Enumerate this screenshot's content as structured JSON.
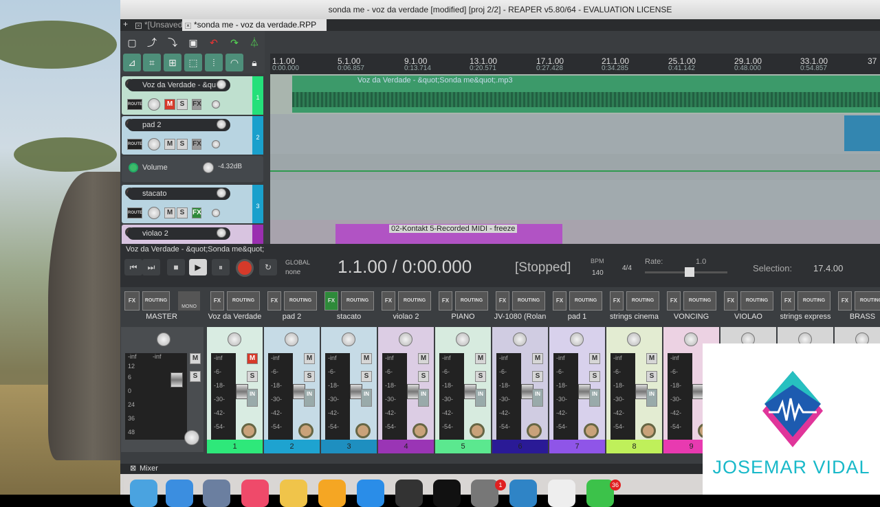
{
  "window": {
    "title": "sonda me - voz da verdade [modified] [proj 2/2] - REAPER v5.80/64 - EVALUATION LICENSE"
  },
  "project_tabs": [
    "*[Unsaved]",
    "*sonda me - voz da verdade.RPP"
  ],
  "ruler": [
    {
      "bar": "1.1.00",
      "time": "0:00.000"
    },
    {
      "bar": "5.1.00",
      "time": "0:06.857"
    },
    {
      "bar": "9.1.00",
      "time": "0:13.714"
    },
    {
      "bar": "13.1.00",
      "time": "0:20.571"
    },
    {
      "bar": "17.1.00",
      "time": "0:27.428"
    },
    {
      "bar": "21.1.00",
      "time": "0:34.285"
    },
    {
      "bar": "25.1.00",
      "time": "0:41.142"
    },
    {
      "bar": "29.1.00",
      "time": "0:48.000"
    },
    {
      "bar": "33.1.00",
      "time": "0:54.857"
    },
    {
      "bar": "37",
      "time": ""
    }
  ],
  "tracks": [
    {
      "name": "Voz da Verdade - &qu",
      "number": "1",
      "color": "#25e07a"
    },
    {
      "name": "pad 2",
      "number": "2",
      "color": "#1aa0cc"
    },
    {
      "name": "stacato",
      "number": "3",
      "color": "#1aa0cc"
    },
    {
      "name": "violao 2",
      "number": "",
      "color": "#9a2fb0"
    }
  ],
  "envelope": {
    "name": "Volume",
    "value": "-4.32dB"
  },
  "track_buttons": {
    "route": "ROUTE",
    "mute": "M",
    "solo": "S",
    "fx": "FX"
  },
  "items": [
    {
      "name": "Voz da Verdade - &quot;Sonda me&quot;.mp3"
    },
    {
      "name": "02-Kontakt 5-Recorded MIDI - freeze"
    }
  ],
  "status_line": "Voz da Verdade - &quot;Sonda me&quot;",
  "transport": {
    "global_label": "GLOBAL",
    "global_mode": "none",
    "position": "1.1.00 / 0:00.000",
    "state": "[Stopped]",
    "bpm_label": "BPM",
    "bpm": "140",
    "time_sig": "4/4",
    "rate_label": "Rate:",
    "rate": "1.0",
    "selection_label": "Selection:",
    "selection": "17.4.00"
  },
  "mixer": {
    "master_name": "MASTER",
    "strip_labels": {
      "fx": "FX",
      "routing": "ROUTING",
      "mono": "MONO",
      "m": "M",
      "s": "S",
      "in": "IN"
    },
    "meter_ticks": [
      "-inf",
      "-6-",
      "-18-",
      "-30-",
      "-42-",
      "-54-"
    ],
    "master_ticks": [
      "-inf",
      "12",
      "6",
      "0",
      "6",
      "12",
      "18",
      "24",
      "30",
      "36",
      "42",
      "48",
      "-inf"
    ],
    "strips": [
      {
        "name": "Voz da Verdade",
        "number": "1",
        "color": "#2ee87a",
        "bg": "#d9ece2"
      },
      {
        "name": "pad 2",
        "number": "2",
        "color": "#1ea3d0",
        "bg": "#c6dbe6"
      },
      {
        "name": "stacato",
        "number": "3",
        "color": "#1e8fc0",
        "bg": "#c6dbe6"
      },
      {
        "name": "violao 2",
        "number": "4",
        "color": "#9a35b5",
        "bg": "#dccde4"
      },
      {
        "name": "PIANO",
        "number": "5",
        "color": "#5be88f",
        "bg": "#d7ebdf"
      },
      {
        "name": "JV-1080 (Rolan",
        "number": "6",
        "color": "#2a1a96",
        "bg": "#d0cce2"
      },
      {
        "name": "pad 1",
        "number": "7",
        "color": "#8f55e8",
        "bg": "#d8d1ec"
      },
      {
        "name": "strings cinema",
        "number": "8",
        "color": "#bff05a",
        "bg": "#e3ecd2"
      },
      {
        "name": "VONCING",
        "number": "9",
        "color": "#e83ab0",
        "bg": "#ecd2e3"
      },
      {
        "name": "VIOLAO",
        "number": "",
        "color": "#888",
        "bg": "#d6d6d6"
      },
      {
        "name": "strings express",
        "number": "",
        "color": "#888",
        "bg": "#d6d6d6"
      },
      {
        "name": "BRASS",
        "number": "",
        "color": "#888",
        "bg": "#d6d6d6"
      }
    ],
    "tab_label": "Mixer"
  },
  "dock_badges": [
    "1",
    "36"
  ],
  "watermark": {
    "text": "JOSEMAR VIDAL"
  }
}
